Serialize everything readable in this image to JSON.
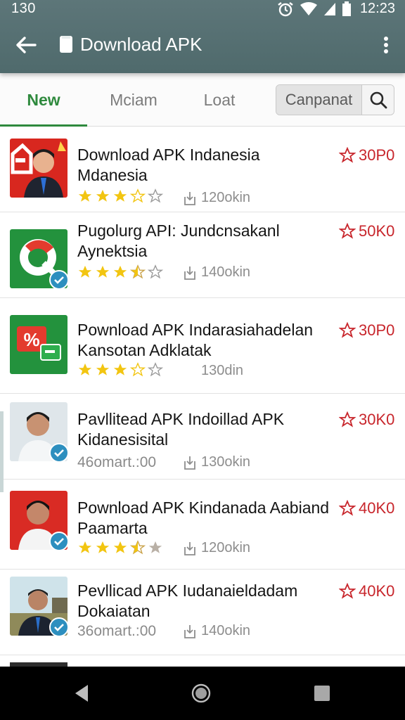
{
  "status_bar": {
    "left_text": "130",
    "time": "12:23"
  },
  "toolbar": {
    "title": "Download APK",
    "icons": [
      "back-arrow-icon",
      "file-icon",
      "more-vert-icon"
    ]
  },
  "tabs": [
    {
      "label": "New",
      "active": true
    },
    {
      "label": "Mciam",
      "active": false
    },
    {
      "label": "Loat",
      "active": false
    }
  ],
  "search": {
    "label": "Canpanat",
    "icon": "search-icon"
  },
  "colors": {
    "header": "#56706f",
    "accent_green": "#2f8a3e",
    "price_red": "#c8262c",
    "star_gold": "#f2c511"
  },
  "items": [
    {
      "title_line1": "Download APK Indanesia",
      "title_line2": "Mdanesia",
      "price": "30P0",
      "stars": 3,
      "meta": "",
      "downloads": "120okin",
      "thumb": "person-red"
    },
    {
      "title_line1": "Pugolurg API: Jundcnsakanl",
      "title_line2": "Aynektsia",
      "price": "50K0",
      "stars": 3.5,
      "meta": "",
      "downloads": "140okin",
      "thumb": "app-green-q"
    },
    {
      "title_line1": "Pownload APK Indarasiahadelan",
      "title_line2": "Kansotan Adklatak",
      "price": "30P0",
      "stars": 3,
      "meta": "",
      "downloads": "130din",
      "thumb": "app-green-percent"
    },
    {
      "title_line1": "Pavllitead APK Indoillad APK",
      "title_line2": "Kidanesisital",
      "price": "30K0",
      "stars": 0,
      "meta": "46omart.:00",
      "downloads": "130okin",
      "thumb": "person-white"
    },
    {
      "title_line1": "Pownload APK Kindanada Aabiand",
      "title_line2": "Paamarta",
      "price": "40K0",
      "stars": 3.5,
      "meta": "",
      "downloads": "120okin",
      "thumb": "person-red2"
    },
    {
      "title_line1": "Pevllicad APK Iudanaieldadam",
      "title_line2": "Dokaiatan",
      "price": "40K0",
      "stars": 0,
      "meta": "36omart.:00",
      "downloads": "140okin",
      "thumb": "person-outdoor"
    }
  ]
}
